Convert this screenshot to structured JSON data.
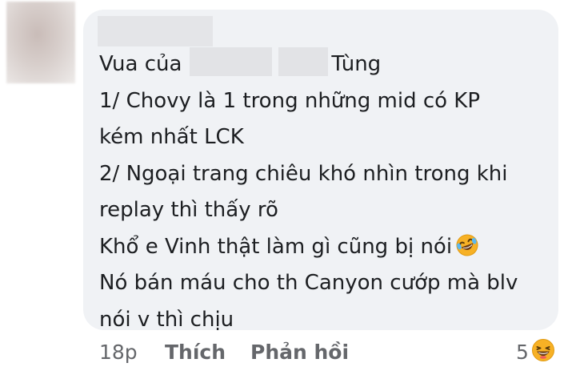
{
  "comment": {
    "lines": [
      {
        "before": "Vua của",
        "after": "Tùng"
      },
      "1/ Chovy là 1 trong những mid có KP",
      "kém nhất LCK",
      "2/ Ngoại trang chiêu khó nhìn trong khi",
      "replay thì thấy rõ",
      "Khổ e Vinh thật làm gì cũng bị nói",
      "Nó bán máu cho th Canyon cướp mà blv",
      "nói v thì chịu"
    ]
  },
  "footer": {
    "time": "18p",
    "like_label": "Thích",
    "reply_label": "Phản hồi"
  },
  "reactions": {
    "count": "5",
    "icon": "laughing-emoji"
  },
  "colors": {
    "bubble": "#f0f2f5",
    "text": "#1c1e21",
    "meta": "#65676b",
    "emoji": "#f7b125"
  }
}
